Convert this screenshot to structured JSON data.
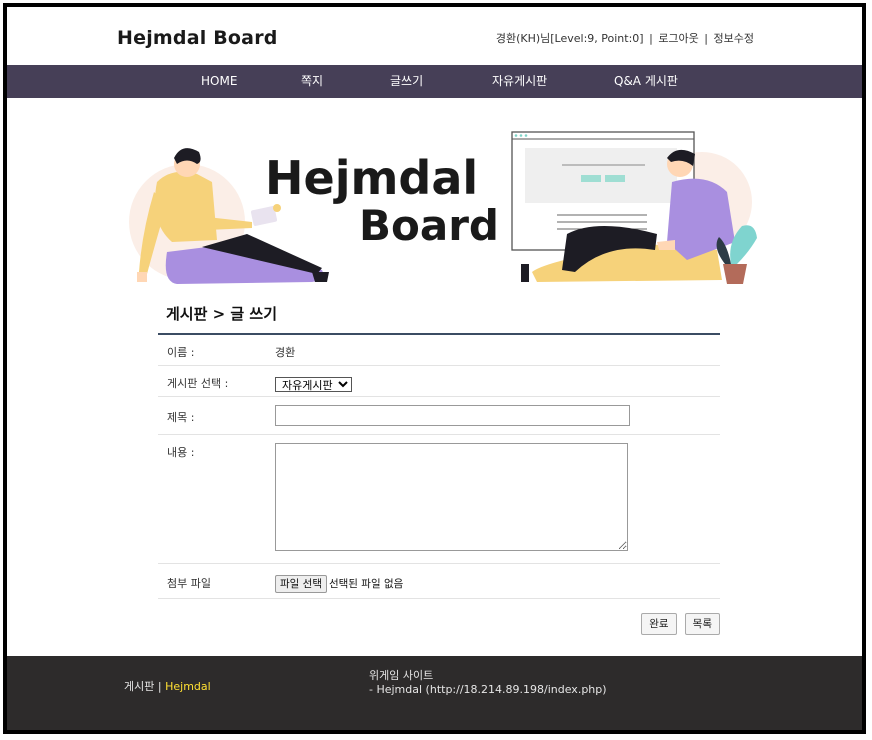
{
  "header": {
    "logo": "Hejmdal Board",
    "user": "경환(KH)님[Level:9, Point:0]",
    "logout": "로그아웃",
    "edit_info": "정보수정",
    "separator": "|"
  },
  "nav": {
    "items": [
      {
        "label": "HOME"
      },
      {
        "label": "쪽지"
      },
      {
        "label": "글쓰기"
      },
      {
        "label": "자유게시판"
      },
      {
        "label": "Q&A 게시판"
      }
    ]
  },
  "banner": {
    "line1": "Hejmdal",
    "line2": "Board"
  },
  "form": {
    "title": "게시판 > 글 쓰기",
    "name_label": "이름 :",
    "name_value": "경환",
    "board_label": "게시판 선택 :",
    "board_selected": "자유게시판",
    "subject_label": "제목 :",
    "subject_value": "",
    "content_label": "내용 :",
    "content_value": "",
    "file_label": "첨부 파일",
    "file_button": "파일 선택",
    "file_status": "선택된 파일 없음",
    "submit_label": "완료",
    "list_label": "목록"
  },
  "footer": {
    "left_prefix": "게시판",
    "left_sep": "|",
    "left_brand": "Hejmdal",
    "right_title": "위게임 사이트",
    "right_link": "- Hejmdal (http://18.214.89.198/index.php)"
  },
  "colors": {
    "nav_bg": "#463f57",
    "footer_bg": "#2d2b2b",
    "footer_brand": "#ffe033",
    "title_rule": "#3b4c63"
  }
}
